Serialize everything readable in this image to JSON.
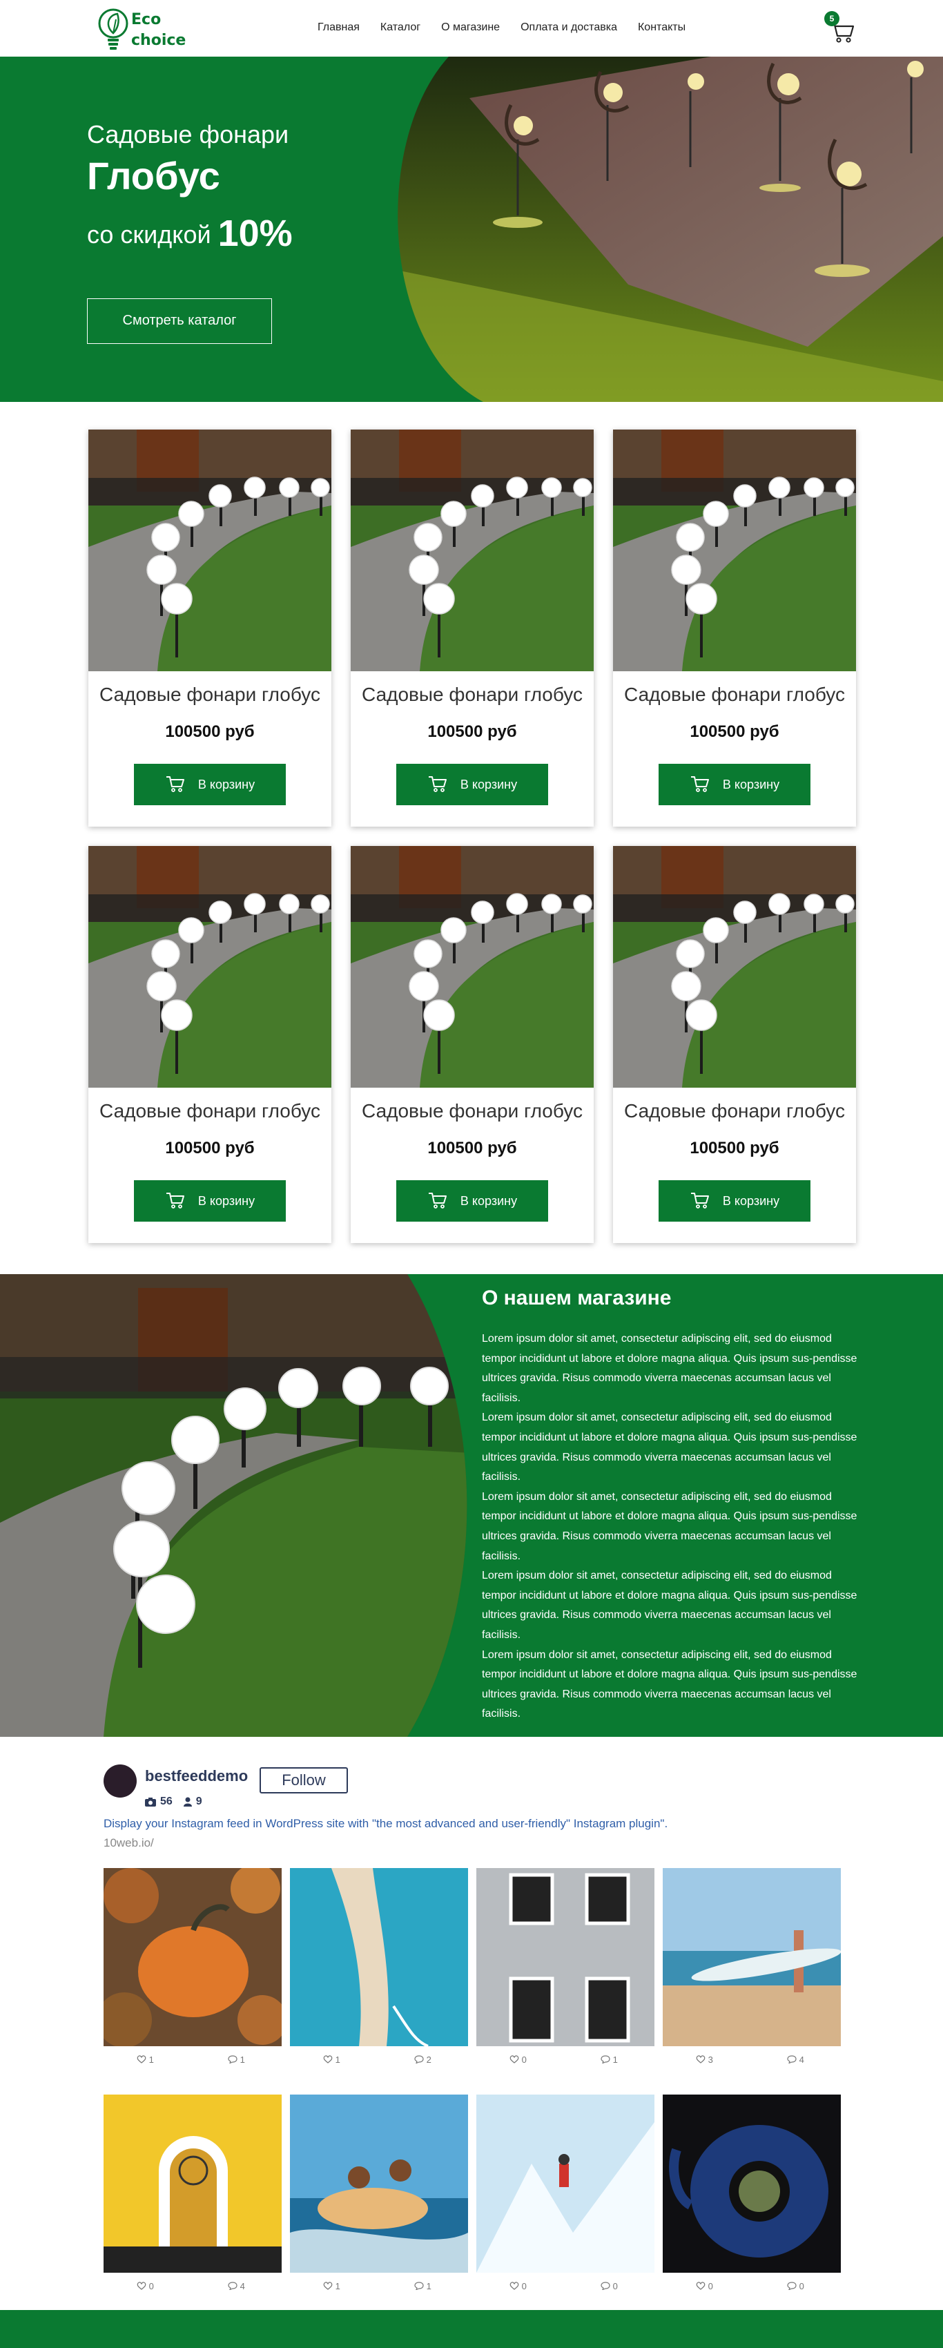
{
  "header": {
    "logo_line1": "Eco",
    "logo_line2": "choice",
    "nav": [
      "Главная",
      "Каталог",
      "О магазине",
      "Оплата и доставка",
      "Контакты"
    ],
    "cart_count": "5"
  },
  "hero": {
    "line1": "Садовые фонари",
    "title": "Глобус",
    "line3": "со скидкой",
    "percent": "10%",
    "button": "Смотреть каталог"
  },
  "products": [
    {
      "title": "Садовые фонари глобус",
      "price": "100500 руб",
      "button": "В корзину"
    },
    {
      "title": "Садовые фонари глобус",
      "price": "100500 руб",
      "button": "В корзину"
    },
    {
      "title": "Садовые фонари глобус",
      "price": "100500 руб",
      "button": "В корзину"
    },
    {
      "title": "Садовые фонари глобус",
      "price": "100500 руб",
      "button": "В корзину"
    },
    {
      "title": "Садовые фонари глобус",
      "price": "100500 руб",
      "button": "В корзину"
    },
    {
      "title": "Садовые фонари глобус",
      "price": "100500 руб",
      "button": "В корзину"
    }
  ],
  "about": {
    "title": "О нашем магазине",
    "paragraphs": [
      "Lorem ipsum dolor sit amet, consectetur adipiscing elit, sed do eiusmod tempor incididunt ut labore et dolore magna aliqua. Quis ipsum sus-pendisse ultrices gravida. Risus commodo viverra maecenas accumsan lacus vel facilisis.",
      "Lorem ipsum dolor sit amet, consectetur adipiscing elit, sed do eiusmod tempor incididunt ut labore et dolore magna aliqua. Quis ipsum sus-pendisse ultrices gravida. Risus commodo viverra maecenas accumsan lacus vel facilisis.",
      "Lorem ipsum dolor sit amet, consectetur adipiscing elit, sed do eiusmod tempor incididunt ut labore et dolore magna aliqua. Quis ipsum sus-pendisse ultrices gravida. Risus commodo viverra maecenas accumsan lacus vel facilisis.",
      "Lorem ipsum dolor sit amet, consectetur adipiscing elit, sed do eiusmod tempor incididunt ut labore et dolore magna aliqua. Quis ipsum sus-pendisse ultrices gravida. Risus commodo viverra maecenas accumsan lacus vel facilisis.",
      "Lorem ipsum dolor sit amet, consectetur adipiscing elit, sed do eiusmod tempor incididunt ut labore et dolore magna aliqua. Quis ipsum sus-pendisse ultrices gravida. Risus commodo viverra maecenas accumsan lacus vel facilisis."
    ]
  },
  "instagram": {
    "username": "bestfeeddemo",
    "follow": "Follow",
    "posts": "56",
    "followers": "9",
    "bio": "Display your Instagram feed in WordPress site with \"the most advanced and user-friendly\" Instagram plugin\".",
    "link": "10web.io/",
    "tiles": [
      {
        "subject": "pumpkin",
        "likes": "1",
        "comments": "1"
      },
      {
        "subject": "pier-aerial",
        "likes": "1",
        "comments": "2"
      },
      {
        "subject": "windows-facade",
        "likes": "0",
        "comments": "1"
      },
      {
        "subject": "surfer-beach",
        "likes": "3",
        "comments": "4"
      },
      {
        "subject": "yellow-door",
        "likes": "0",
        "comments": "4"
      },
      {
        "subject": "rafting",
        "likes": "1",
        "comments": "1"
      },
      {
        "subject": "ice-climber",
        "likes": "0",
        "comments": "0"
      },
      {
        "subject": "tea-kettle",
        "likes": "0",
        "comments": "0"
      }
    ]
  },
  "colors": {
    "brand_green": "#0a7a31",
    "insta_navy": "#2d3a5a",
    "insta_link": "#2f5ea8"
  }
}
